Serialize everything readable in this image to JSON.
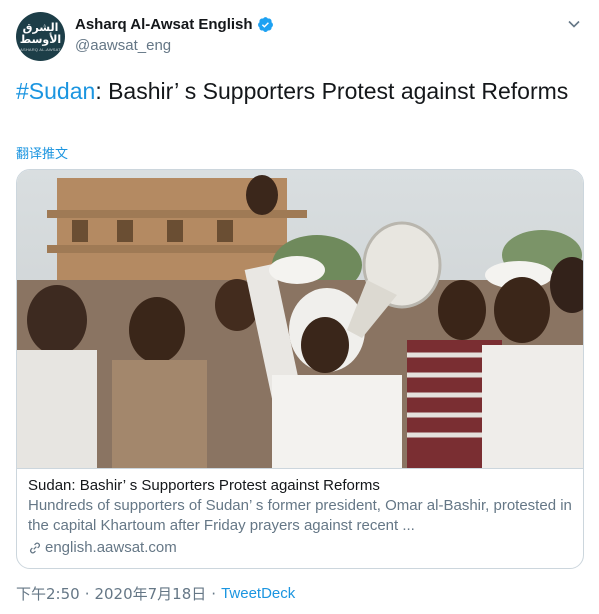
{
  "account": {
    "display_name": "Asharq Al-Awsat English",
    "handle": "@aawsat_eng",
    "avatar_line1": "الشرق",
    "avatar_line2": "الأوسط",
    "avatar_line3": "ASHARQ AL-AWSAT"
  },
  "tweet": {
    "hashtag": "#Sudan",
    "text_rest": ": Bashir’ s Supporters Protest against Reforms",
    "translate_label": "翻译推文"
  },
  "card": {
    "title": "Sudan: Bashir’ s Supporters Protest against Reforms",
    "description": "Hundreds of supporters of Sudan’ s former president, Omar al-Bashir, protested in the capital Khartoum after Friday prayers against recent ...",
    "domain": "english.aawsat.com"
  },
  "meta": {
    "time": "下午2:50",
    "separator1": "·",
    "date": "2020年7月18日",
    "separator2": "·",
    "source": "TweetDeck"
  },
  "icons": {
    "verified": "verified-badge-icon",
    "caret": "chevron-down-icon",
    "link": "link-icon"
  },
  "colors": {
    "link_blue": "#1b95e0",
    "text": "#14171a",
    "muted": "#657786",
    "border": "#ccd6dd",
    "avatar_bg": "#1d3e48"
  }
}
